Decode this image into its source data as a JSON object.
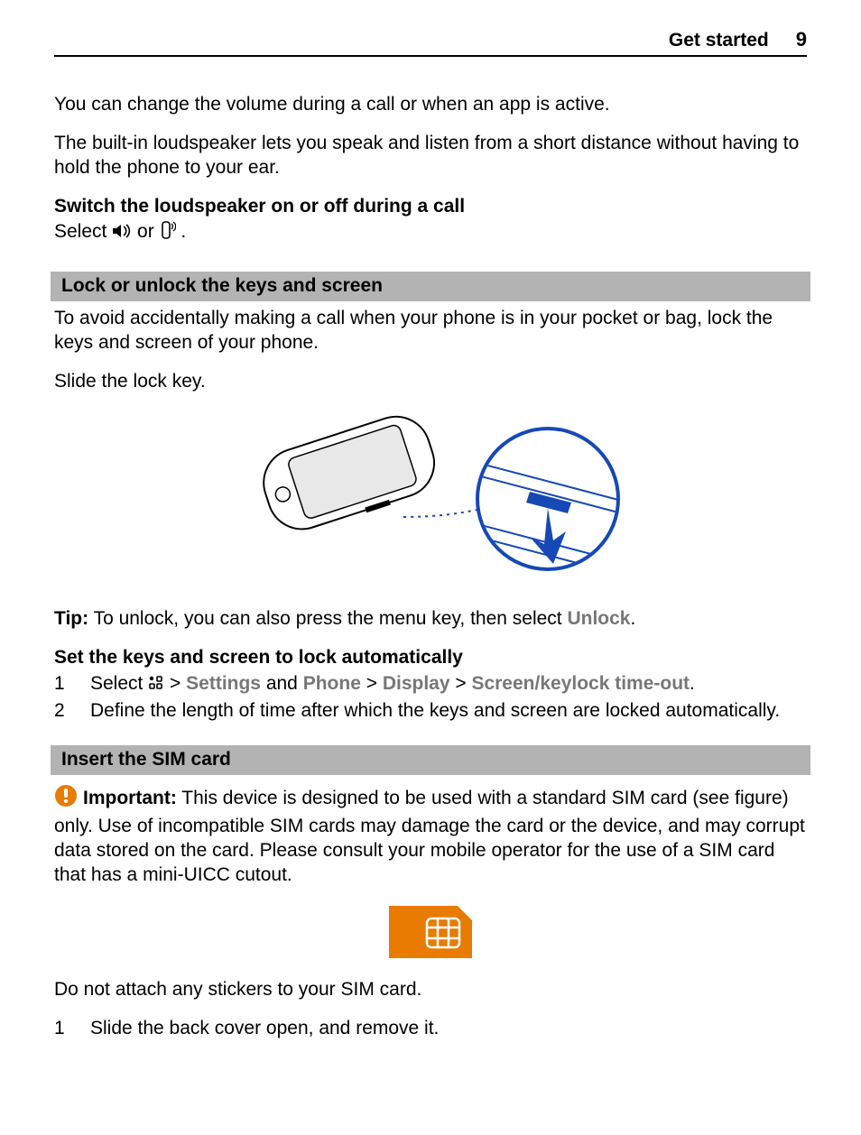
{
  "header": {
    "title": "Get started",
    "page": "9"
  },
  "body": {
    "p1": "You can change the volume during a call or when an app is active.",
    "p2": "The built-in loudspeaker lets you speak and listen from a short distance without having to hold the phone to your ear.",
    "h1": "Switch the loudspeaker on or off during a call",
    "select_prefix": "Select ",
    "select_or": " or ",
    "select_suffix": "."
  },
  "lock_section": {
    "bar": "Lock or unlock the keys and screen",
    "p1": "To avoid accidentally making a call when your phone is in your pocket or bag, lock the keys and screen of your phone.",
    "p2": "Slide the lock key.",
    "tip_label": "Tip:",
    "tip_body_before": " To unlock, you can also press the menu key, then select ",
    "tip_unlock": "Unlock",
    "tip_body_after": ".",
    "h_auto": "Set the keys and screen to lock automatically",
    "step1_num": "1",
    "step1_prefix": "Select ",
    "step1_gt1": " > ",
    "step1_settings": "Settings",
    "step1_and": " and ",
    "step1_phone": "Phone",
    "step1_gt2": "  > ",
    "step1_display": "Display",
    "step1_gt3": "  > ",
    "step1_timeout": "Screen/keylock time-out",
    "step1_suffix": ".",
    "step2_num": "2",
    "step2_body": "Define the length of time after which the keys and screen are locked automatically."
  },
  "sim_section": {
    "bar": "Insert the SIM card",
    "imp_label": "Important:",
    "imp_body": " This device is designed to be used with a standard SIM card (see figure) only. Use of incompatible SIM cards may damage the card or the device, and may corrupt data stored on the card. Please consult your mobile operator for the use of a SIM card that has a mini-UICC cutout.",
    "p_stickers": "Do not attach any stickers to your SIM card.",
    "step1_num": "1",
    "step1_body": "Slide the back cover open, and remove it."
  }
}
